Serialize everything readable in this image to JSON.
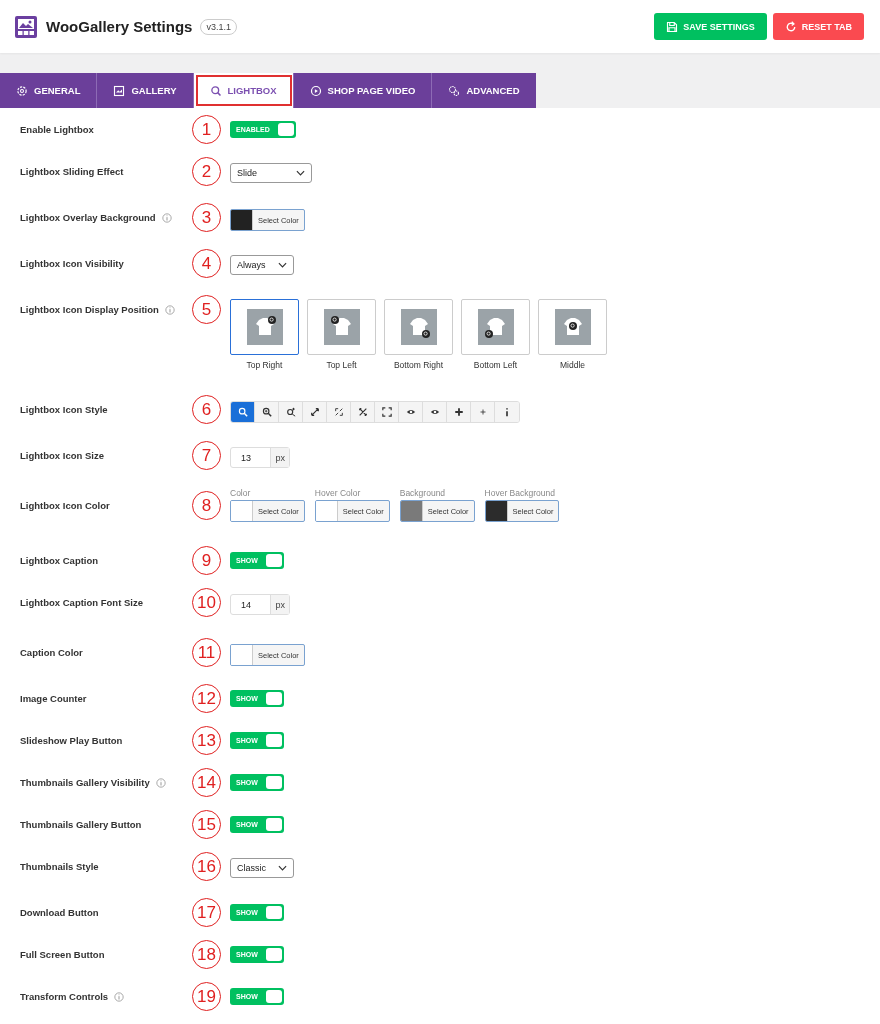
{
  "header": {
    "title": "WooGallery Settings",
    "version": "v3.1.1",
    "buttons": [
      {
        "kind": "save",
        "label": "SAVE SETTINGS"
      },
      {
        "kind": "reset",
        "label": "RESET TAB"
      }
    ]
  },
  "tabs": [
    {
      "kind": "general",
      "label": "GENERAL",
      "selected": false
    },
    {
      "kind": "gallery",
      "label": "GALLERY",
      "selected": false
    },
    {
      "kind": "lightbox",
      "label": "LIGHTBOX",
      "selected": true
    },
    {
      "kind": "video",
      "label": "SHOP PAGE VIDEO",
      "selected": false
    },
    {
      "kind": "advanced",
      "label": "ADVANCED",
      "selected": false
    }
  ],
  "settings": [
    {
      "marker": "1",
      "label": "Enable Lightbox",
      "info": false,
      "kind": "toggle",
      "text": "ENABLED",
      "on": true
    },
    {
      "marker": "2",
      "label": "Lightbox Sliding Effect",
      "info": false,
      "kind": "select",
      "value": "Slide",
      "wide": true
    },
    {
      "marker": "3",
      "label": "Lightbox Overlay Background",
      "info": true,
      "kind": "color",
      "button": "Select Color",
      "color": "#222222"
    },
    {
      "marker": "4",
      "label": "Lightbox Icon Visibility",
      "info": false,
      "kind": "select",
      "value": "Always",
      "wide": false
    },
    {
      "marker": "5",
      "label": "Lightbox Icon Display Position",
      "info": true,
      "kind": "position",
      "options": [
        {
          "label": "Top Right",
          "selected": true
        },
        {
          "label": "Top Left",
          "selected": false
        },
        {
          "label": "Bottom Right",
          "selected": false
        },
        {
          "label": "Bottom Left",
          "selected": false
        },
        {
          "label": "Middle",
          "selected": false
        }
      ]
    },
    {
      "marker": "6",
      "label": "Lightbox Icon Style",
      "info": false,
      "kind": "iconstyle",
      "options": [
        {
          "selected": true
        },
        {
          "selected": false
        },
        {
          "selected": false
        },
        {
          "selected": false
        },
        {
          "selected": false
        },
        {
          "selected": false
        },
        {
          "selected": false
        },
        {
          "selected": false
        },
        {
          "selected": false
        },
        {
          "selected": false
        },
        {
          "selected": false
        },
        {
          "selected": false
        }
      ]
    },
    {
      "marker": "7",
      "label": "Lightbox Icon Size",
      "info": false,
      "kind": "number",
      "value": "13",
      "unit": "px"
    },
    {
      "marker": "8",
      "label": "Lightbox Icon Color",
      "info": false,
      "kind": "colors",
      "pickers": [
        {
          "caption": "Color",
          "button": "Select Color",
          "color": "#ffffff"
        },
        {
          "caption": "Hover Color",
          "button": "Select Color",
          "color": "#ffffff"
        },
        {
          "caption": "Background",
          "button": "Select Color",
          "color": "#7a7a7a"
        },
        {
          "caption": "Hover Background",
          "button": "Select Color",
          "color": "#2c2c2c"
        }
      ]
    },
    {
      "marker": "9",
      "label": "Lightbox Caption",
      "info": false,
      "kind": "toggle",
      "text": "SHOW",
      "on": true
    },
    {
      "marker": "10",
      "label": "Lightbox Caption Font Size",
      "info": false,
      "kind": "number",
      "value": "14",
      "unit": "px"
    },
    {
      "marker": "11",
      "label": "Caption Color",
      "info": false,
      "kind": "color",
      "button": "Select Color",
      "color": "#ffffff"
    },
    {
      "marker": "12",
      "label": "Image Counter",
      "info": false,
      "kind": "toggle",
      "text": "SHOW",
      "on": true
    },
    {
      "marker": "13",
      "label": "Slideshow Play Button",
      "info": false,
      "kind": "toggle",
      "text": "SHOW",
      "on": true
    },
    {
      "marker": "14",
      "label": "Thumbnails Gallery Visibility",
      "info": true,
      "kind": "toggle",
      "text": "SHOW",
      "on": true
    },
    {
      "marker": "15",
      "label": "Thumbnails Gallery Button",
      "info": false,
      "kind": "toggle",
      "text": "SHOW",
      "on": true
    },
    {
      "marker": "16",
      "label": "Thumbnails Style",
      "info": false,
      "kind": "select",
      "value": "Classic",
      "wide": false
    },
    {
      "marker": "17",
      "label": "Download Button",
      "info": false,
      "kind": "toggle",
      "text": "SHOW",
      "on": true
    },
    {
      "marker": "18",
      "label": "Full Screen Button",
      "info": false,
      "kind": "toggle",
      "text": "SHOW",
      "on": true
    },
    {
      "marker": "19",
      "label": "Transform Controls",
      "info": true,
      "kind": "toggle",
      "text": "SHOW",
      "on": true
    }
  ]
}
